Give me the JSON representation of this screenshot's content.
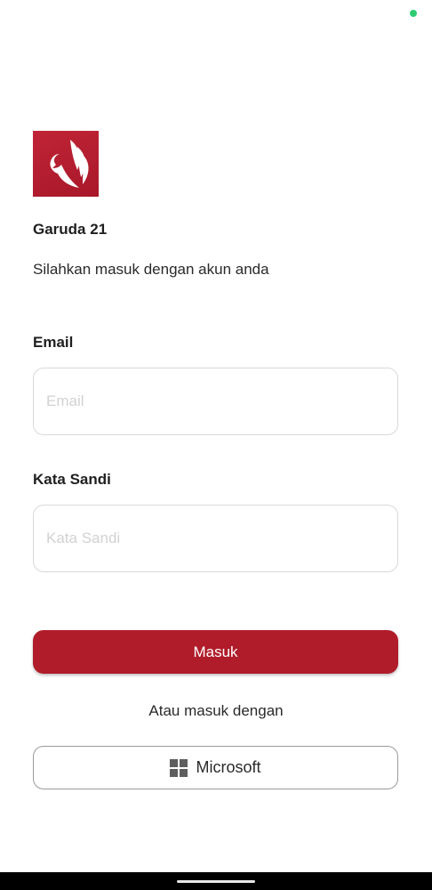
{
  "app": {
    "name": "Garuda 21",
    "subtitle": "Silahkan masuk dengan akun anda",
    "brand_color": "#b01c2a",
    "logo_icon": "garuda-bird-logo"
  },
  "form": {
    "email": {
      "label": "Email",
      "value": "",
      "placeholder": "Email"
    },
    "password": {
      "label": "Kata Sandi",
      "value": "",
      "placeholder": "Kata Sandi"
    },
    "submit_label": "Masuk"
  },
  "alt_login": {
    "text": "Atau masuk dengan",
    "microsoft_label": "Microsoft",
    "microsoft_icon": "windows-logo-icon"
  },
  "status": {
    "indicator_color": "#2ecc71"
  }
}
